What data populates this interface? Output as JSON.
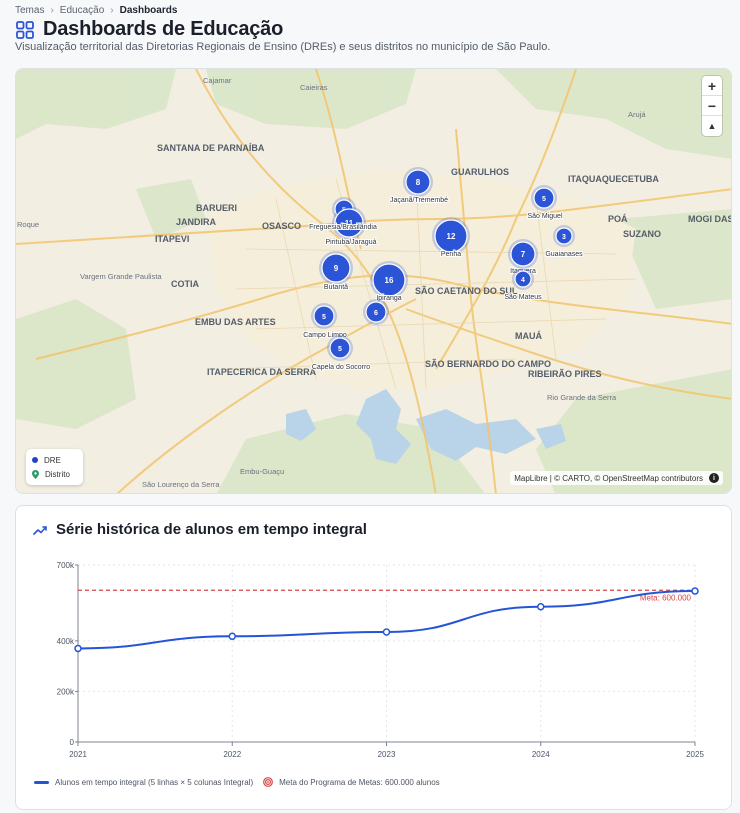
{
  "breadcrumb": [
    "Temas",
    "Educação",
    "Dashboards"
  ],
  "page": {
    "title": "Dashboards de Educação",
    "subtitle": "Visualização territorial das Diretorias Regionais de Ensino (DREs) e seus distritos no município de São Paulo."
  },
  "map": {
    "place_labels": [
      "Cajamar",
      "Caieiras",
      "Arujá",
      "SANTANA DE PARNAÍBA",
      "GUARULHOS",
      "ITAQUAQUECETUBA",
      "BARUERI",
      "JANDIRA",
      "OSASCO",
      "POÁ",
      "MOGI DAS",
      "ITAPEVI",
      "SUZANO",
      "Roque",
      "Vargem Grande Paulista",
      "COTIA",
      "SÃO CAETANO DO SUL",
      "EMBU DAS ARTES",
      "MAUÁ",
      "SÃO BERNARDO DO CAMPO",
      "ITAPECERICA DA SERRA",
      "RIBEIRÃO PIRES",
      "Rio Grande da Serra",
      "Embu-Guaçu",
      "São Lourenço da Serra"
    ],
    "clusters": [
      {
        "count": "8",
        "label": "Jaçanã/Tremembé"
      },
      {
        "count": "5",
        "label": "São Miguel"
      },
      {
        "count": "5",
        "label": ""
      },
      {
        "count": "11",
        "label": "Freguesia/Brasilândia"
      },
      {
        "count": "",
        "label": "Pirituba/Jaraguá"
      },
      {
        "count": "12",
        "label": "Penha"
      },
      {
        "count": "3",
        "label": "Guaianases"
      },
      {
        "count": "7",
        "label": "Itaquera"
      },
      {
        "count": "4",
        "label": "São Mateus"
      },
      {
        "count": "9",
        "label": "Butantã"
      },
      {
        "count": "16",
        "label": "Ipiranga"
      },
      {
        "count": "6",
        "label": ""
      },
      {
        "count": "5",
        "label": "Campo Limpo"
      },
      {
        "count": "5",
        "label": "Capela do Socorro"
      }
    ],
    "legend": {
      "dre": "DRE",
      "distrito": "Distrito"
    },
    "attribution": "MapLibre | © CARTO, © OpenStreetMap contributors",
    "zoom_in": "+",
    "zoom_out": "−",
    "compass": "▲",
    "colors": {
      "cluster": "#2b55d6",
      "distrito": "#2e9c6a"
    }
  },
  "chart_section": {
    "title": "Série histórica de alunos em tempo integral",
    "legend_series": "Alunos em tempo integral (5 linhas × 5 colunas Integral)",
    "legend_target": "Meta do Programa de Metas: 600.000 alunos"
  },
  "chart_data": {
    "type": "line",
    "x": [
      "2021",
      "2022",
      "2023",
      "2024",
      "2025"
    ],
    "series": [
      {
        "name": "Alunos em tempo integral (5 linhas × 5 colunas Integral)",
        "values": [
          370000,
          418000,
          435000,
          535000,
          597000
        ]
      }
    ],
    "target": {
      "label": "Meta: 600.000",
      "value": 600000
    },
    "y_ticks": [
      "0",
      "200k",
      "400k",
      "700k"
    ],
    "y_tick_values": [
      0,
      200000,
      400000,
      700000
    ],
    "ylim": [
      0,
      700000
    ],
    "grid": true,
    "colors": {
      "line": "#2455d8",
      "target": "#d64545"
    }
  }
}
